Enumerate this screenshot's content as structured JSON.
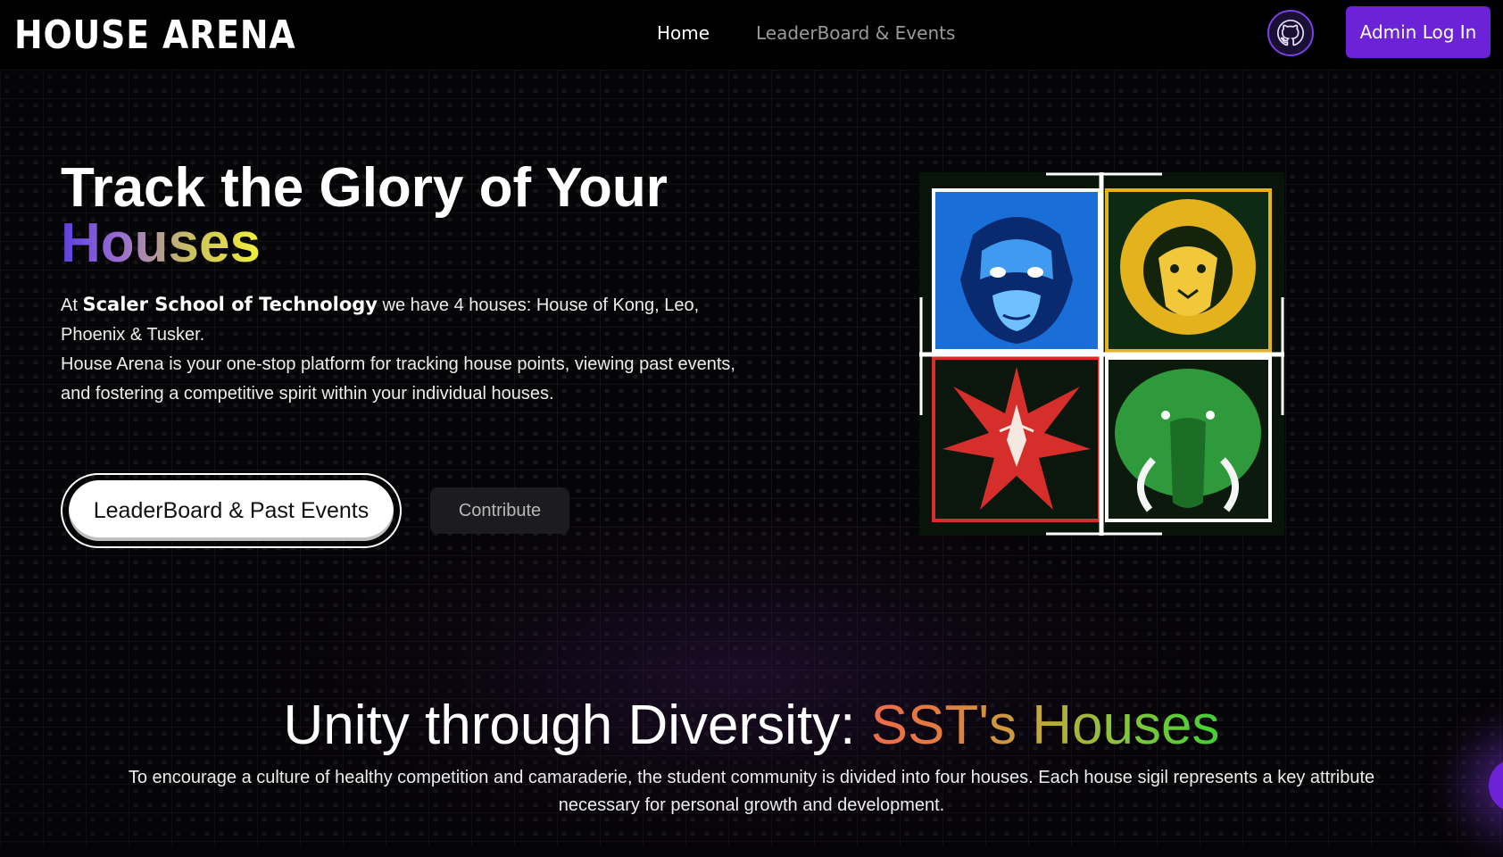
{
  "nav": {
    "logo": "HOUSE ARENA",
    "links": [
      "Home",
      "LeaderBoard & Events"
    ],
    "admin_label": "Admin Log In"
  },
  "hero": {
    "title_line1": "Track the Glory of Your",
    "title_accent": "Houses",
    "desc_intro": "At ",
    "desc_school": "Scaler School of Technology",
    "desc_houses": " we have 4 houses: House of Kong, Leo, Phoenix & Tusker.",
    "desc_platform": "House Arena is your one-stop platform for tracking house points, viewing past events, and fostering a competitive spirit within your individual houses.",
    "primary_button": "LeaderBoard & Past Events",
    "secondary_button": "Contribute"
  },
  "section": {
    "title": "Unity through Diversity: ",
    "title_accent": "SST's Houses",
    "description": "To encourage a culture of healthy competition and camaraderie, the student community is divided into four houses. Each house sigil represents a key attribute necessary for personal growth and development."
  },
  "colors": {
    "brand_purple": "#6c22d6",
    "kong_blue": "#1e6fd8",
    "leo_gold": "#e3b21c",
    "phoenix_red": "#d62e2a",
    "tusker_green": "#2f9a3c"
  },
  "icons": {
    "github": "github-icon",
    "sigils": [
      "gorilla-sigil-icon",
      "lion-sigil-icon",
      "phoenix-sigil-icon",
      "elephant-sigil-icon"
    ]
  }
}
